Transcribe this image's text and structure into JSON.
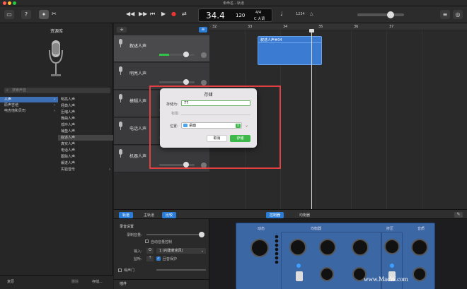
{
  "window": {
    "title": "未命名 - 轨道"
  },
  "toolbar": {
    "tempo_label": "34.4",
    "bpm": "120",
    "time_sig": "4/4",
    "key": "C 大调"
  },
  "library": {
    "title": "资源库",
    "search_placeholder": "搜索声音",
    "categories": [
      "人声",
      "原声吉他",
      "电吉他和贝司"
    ],
    "subitems": [
      "明亮人声",
      "经典人声",
      "压缩人声",
      "舞曲人声",
      "低吟人声",
      "铺垫人声",
      "叙述人声",
      "真实人声",
      "电话人声",
      "跟踪人声",
      "缓进人声",
      "实验音乐"
    ],
    "revert_label": "复原",
    "delete_label": "删除",
    "save_label": "存储..."
  },
  "tracks": [
    {
      "name": "叙述人声"
    },
    {
      "name": "明亮人声"
    },
    {
      "name": "模糊人声"
    },
    {
      "name": "电话人声"
    },
    {
      "name": "机器人声"
    }
  ],
  "timeline": {
    "ruler": [
      "32",
      "33",
      "34",
      "35",
      "36",
      "37"
    ],
    "region_label": "叙述人声#04"
  },
  "dialog": {
    "title": "存储",
    "name_label": "存储为:",
    "name_value": "77",
    "tags_label": "标签:",
    "where_label": "位置:",
    "where_value": "桌面",
    "cancel_label": "取消",
    "save_label": "存储"
  },
  "smart": {
    "tabs": [
      "轨道",
      "主轨道",
      "比较"
    ],
    "mode_tabs": [
      "控制器",
      "均衡器"
    ],
    "section_title": "录音设置",
    "record_level_label": "录制音量:",
    "auto_level_label": "自动音量控制",
    "input_label": "输入:",
    "input_value": "1 (内建麦克风)",
    "monitor_label": "监听:",
    "feedback_label": "回音保护",
    "noise_gate_label": "噪声门",
    "plugins_label": "插件",
    "panel_headers": [
      "动态",
      "均衡器",
      "挤压",
      "音质"
    ],
    "watermark": "www.MacW.com"
  },
  "colors": {
    "accent": "#2a7cd6",
    "dialog_save": "#3db84a",
    "highlight": "#e04040"
  }
}
